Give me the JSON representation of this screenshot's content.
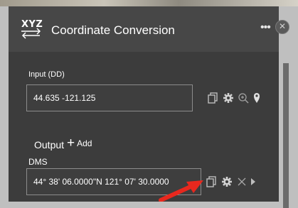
{
  "header": {
    "icon_text": "XYZ",
    "title": "Coordinate Conversion",
    "menu": "•••",
    "close": "✕"
  },
  "input": {
    "label": "Input (DD)",
    "value": "44.635 -121.125"
  },
  "output": {
    "label": "Output",
    "add_label": "Add",
    "add_symbol": "+",
    "entries": [
      {
        "format": "DMS",
        "value": "44° 38' 06.0000\"N 121° 07' 30.0000"
      }
    ]
  },
  "colors": {
    "panel": "#3c3c3c",
    "header": "#474747",
    "arrow": "#e8281e"
  }
}
